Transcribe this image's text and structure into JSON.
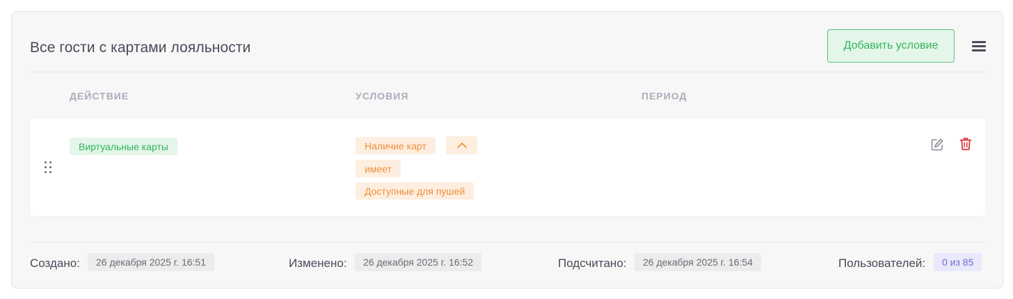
{
  "header": {
    "title": "Все гости с картами лояльности",
    "add_button_label": "Добавить условие",
    "menu_icon": "hamburger-menu-icon"
  },
  "columns": {
    "action": "ДЕЙСТВИЕ",
    "conditions": "УСЛОВИЯ",
    "period": "ПЕРИОД"
  },
  "rule": {
    "action_tag": "Виртуальные карты",
    "conditions": [
      "Наличие карт",
      "имеет",
      "Доступные для пушей"
    ],
    "period": "",
    "icons": [
      "drag-handle-icon",
      "chevron-up-icon",
      "edit-icon",
      "trash-icon"
    ]
  },
  "footer": {
    "created_label": "Создано:",
    "created_value": "26 декабря 2025 г. 16:51",
    "modified_label": "Изменено:",
    "modified_value": "26 декабря 2025 г. 16:52",
    "counted_label": "Подсчитано:",
    "counted_value": "26 декабря 2025 г. 16:54",
    "users_label": "Пользователей:",
    "users_value": "0 из 85"
  },
  "colors": {
    "green_accent": "#34b45c",
    "orange_accent": "#f0903a",
    "danger": "#d9363e",
    "purple_badge": "#6b6bd6"
  }
}
